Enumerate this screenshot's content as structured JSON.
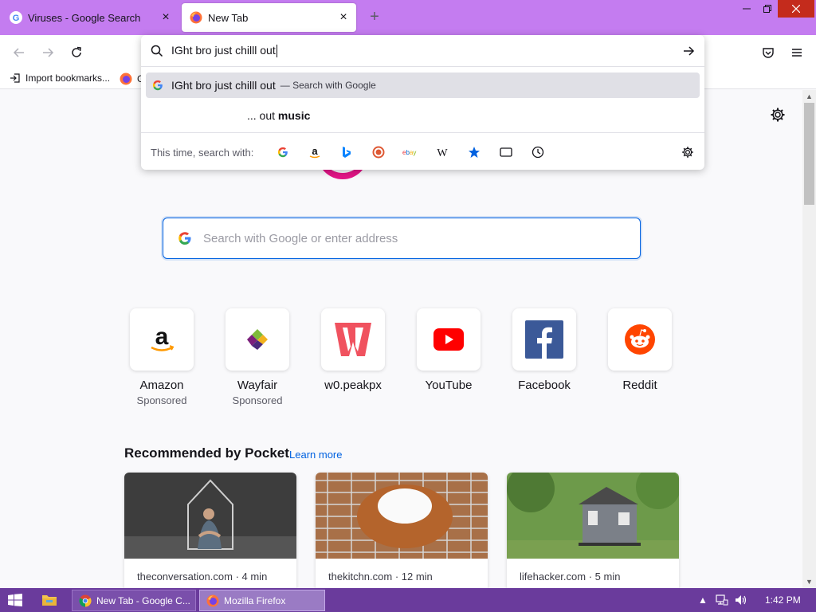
{
  "tabs": [
    {
      "title": "Viruses - Google Search",
      "icon": "google-icon"
    },
    {
      "title": "New Tab",
      "icon": "firefox-icon",
      "active": true
    }
  ],
  "bookmarks": {
    "import_label": "Import bookmarks...",
    "second_label": "G"
  },
  "urlbar": {
    "query": "IGht bro just chilll out",
    "suggestion_query": "IGht bro just chilll out",
    "suggestion_suffix": "— Search with Google",
    "suggestion2_prefix": "... out",
    "suggestion2_bold": "music",
    "engines_label": "This time, search with:",
    "engines": [
      "google-icon",
      "amazon-icon",
      "bing-icon",
      "duckduckgo-icon",
      "ebay-icon",
      "wikipedia-icon",
      "bookmarks-star-icon",
      "tabs-icon",
      "history-clock-icon"
    ]
  },
  "search": {
    "placeholder": "Search with Google or enter address"
  },
  "top_sites": [
    {
      "name": "Amazon",
      "sponsored": "Sponsored",
      "icon": "amazon-logo-icon"
    },
    {
      "name": "Wayfair",
      "sponsored": "Sponsored",
      "icon": "wayfair-logo-icon"
    },
    {
      "name": "w0.peakpx",
      "sponsored": "",
      "icon": "peakpx-logo-icon"
    },
    {
      "name": "YouTube",
      "sponsored": "",
      "icon": "youtube-logo-icon"
    },
    {
      "name": "Facebook",
      "sponsored": "",
      "icon": "facebook-logo-icon"
    },
    {
      "name": "Reddit",
      "sponsored": "",
      "icon": "reddit-logo-icon"
    }
  ],
  "pocket": {
    "heading": "Recommended by Pocket",
    "learn_more": "Learn more",
    "cards": [
      {
        "source": "theconversation.com · 4 min"
      },
      {
        "source": "thekitchn.com · 12 min"
      },
      {
        "source": "lifehacker.com · 5 min"
      }
    ]
  },
  "taskbar": {
    "items": [
      {
        "label": "New Tab - Google C..."
      },
      {
        "label": "Mozilla Firefox"
      }
    ],
    "clock": "1:42 PM"
  },
  "colors": {
    "tabstrip": "#c47cf0",
    "taskbar": "#6a3b9c",
    "accent": "#0061e0"
  }
}
